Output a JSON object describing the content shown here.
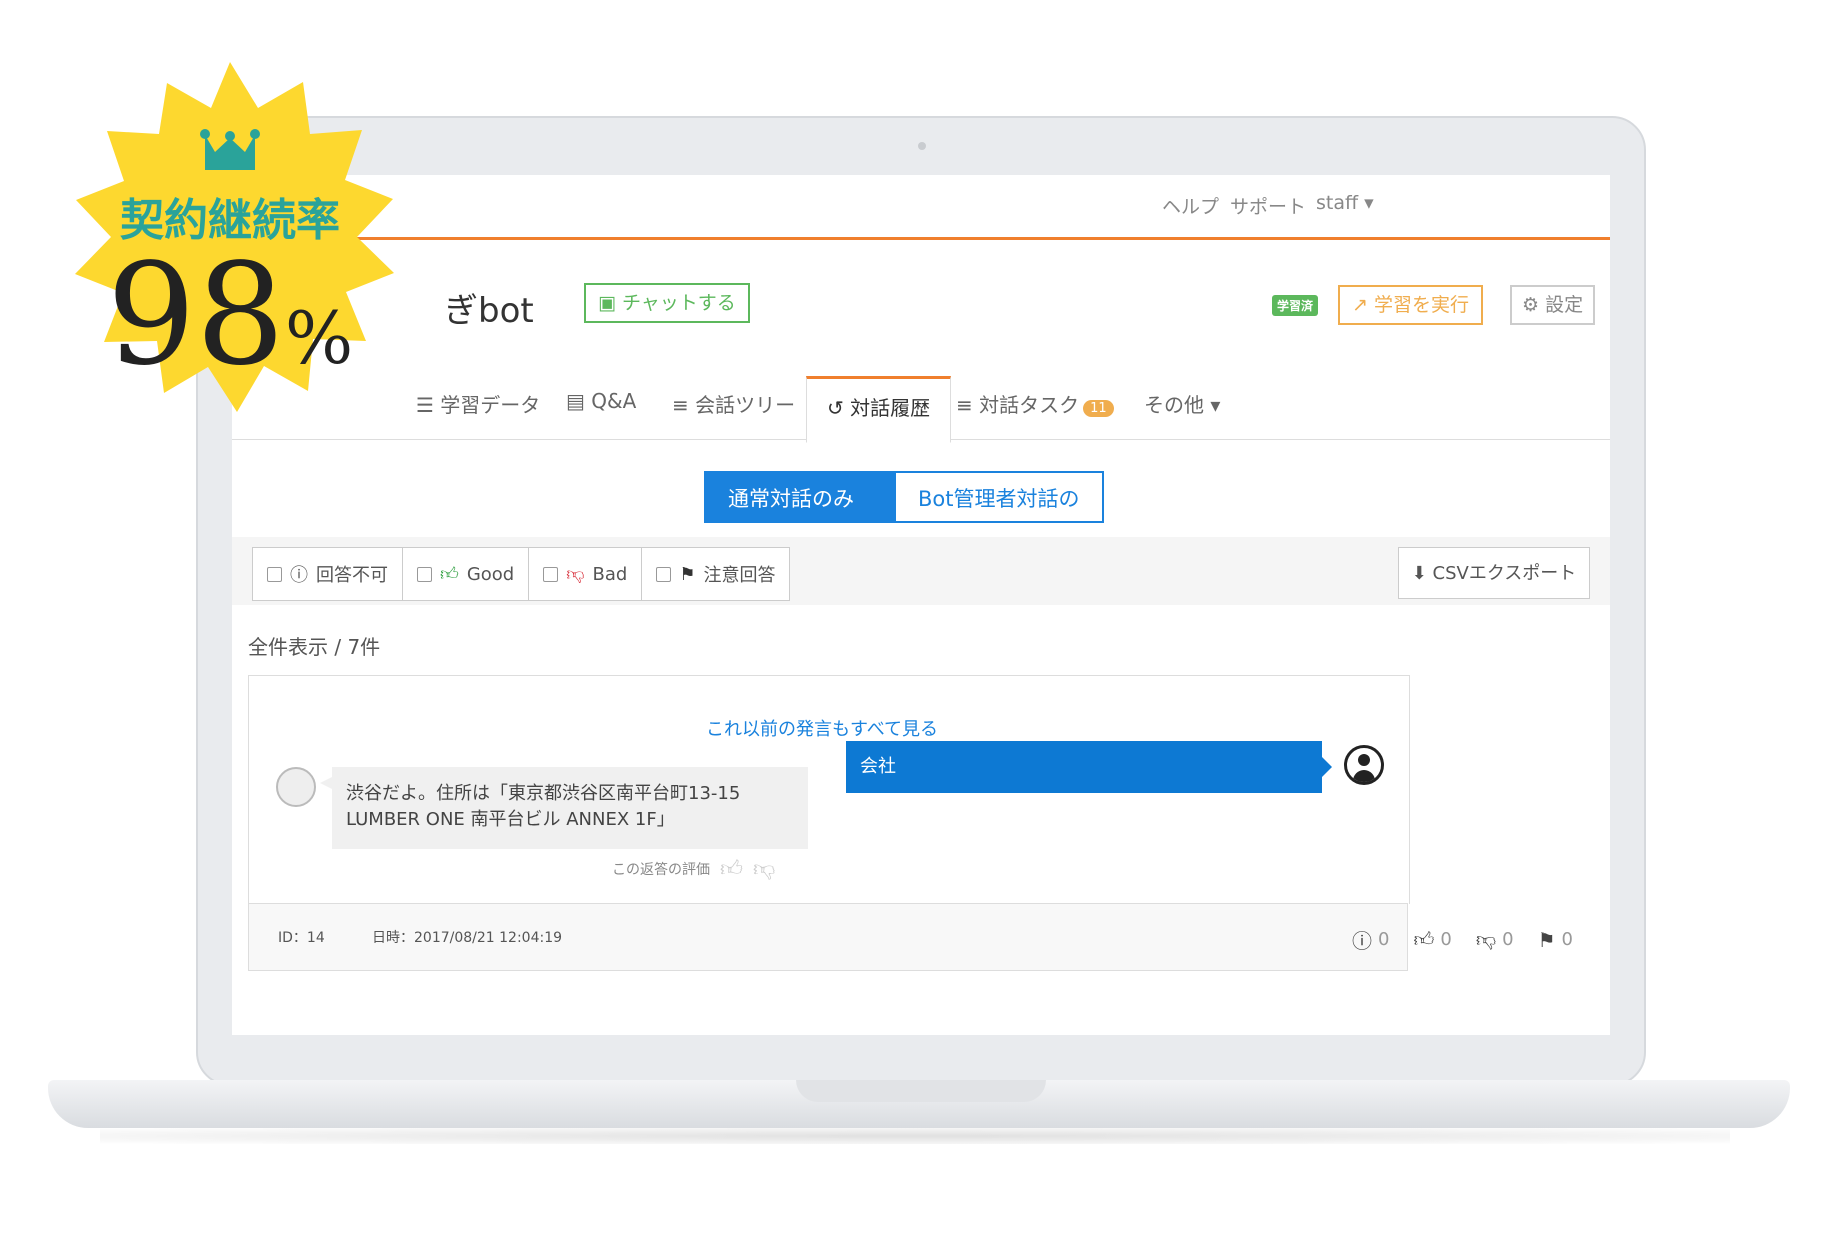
{
  "topnav": {
    "help": "ヘルプ",
    "support": "サポート",
    "user": "staff ▾"
  },
  "header": {
    "bot_name": "ぎbot",
    "chat_button": "チャットする",
    "learned_badge": "学習済",
    "run_learning": "学習を実行",
    "settings": "設定"
  },
  "tabs": {
    "learning_data": "学習データ",
    "qa": "Q&A",
    "conversation_tree": "会話ツリー",
    "history": "対話履歴",
    "tasks": "対話タスク",
    "task_count": "11",
    "other": "その他 ▾"
  },
  "toggle": {
    "normal": "通常対話のみ",
    "admin": "Bot管理者対話のみ"
  },
  "filters": {
    "unanswerable": "回答不可",
    "good": "Good",
    "bad": "Bad",
    "caution": "注意回答",
    "csv": "CSVエクスポート"
  },
  "count_text": "全件表示 / 7件",
  "conversation": {
    "see_all": "これ以前の発言もすべて見る",
    "bot_message": "渋谷だよ。住所は「東京都渋谷区南平台町13-15 LUMBER ONE 南平台ビル ANNEX 1F」",
    "rating_label": "この返答の評価",
    "user_message": "会社"
  },
  "footer": {
    "id": "ID：14",
    "datetime": "日時：2017/08/21 12:04:19",
    "unanswerable_count": "0",
    "good_count": "0",
    "bad_count": "0",
    "flag_count": "0"
  },
  "badge": {
    "label": "契約継続率",
    "value": "98",
    "unit": "%"
  },
  "colors": {
    "accent": "#f07f2d",
    "primary": "#1a82dd",
    "success": "#5cb85c",
    "warning": "#f0ad4e",
    "badge": "#fdd82f",
    "badge_text": "#2aa39a"
  }
}
